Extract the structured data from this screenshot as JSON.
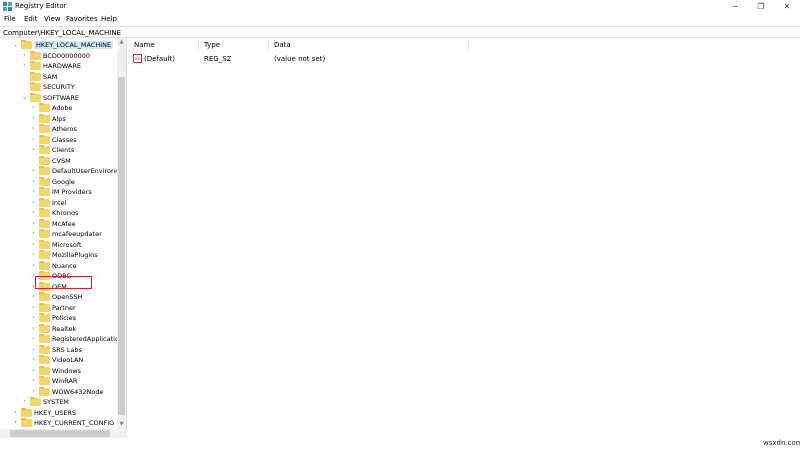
{
  "window": {
    "title": "Registry Editor",
    "minimize": "─",
    "maximize": "❐",
    "close": "✕"
  },
  "menu": [
    "File",
    "Edit",
    "View",
    "Favorites",
    "Help"
  ],
  "address": "Computer\\HKEY_LOCAL_MACHINE",
  "tree": {
    "root": "HKEY_LOCAL_MACHINE",
    "hklm_children": [
      "BCD00000000",
      "HARDWARE",
      "SAM",
      "SECURITY",
      "SOFTWARE"
    ],
    "software_children": [
      "Adobe",
      "Alps",
      "Atheros",
      "Classes",
      "Clients",
      "CVSM",
      "DefaultUserEnvironm",
      "Google",
      "IM Providers",
      "Intel",
      "Khronos",
      "McAfee",
      "mcafeeupdater",
      "Microsoft",
      "MozillaPlugins",
      "Nuance",
      "ODBC",
      "OEM",
      "OpenSSH",
      "Partner",
      "Policies",
      "Realtek",
      "RegisteredApplicatio",
      "SRS Labs",
      "VideoLAN",
      "Windows",
      "WinRAR",
      "WOW6432Node"
    ],
    "after_software": [
      "SYSTEM"
    ],
    "other_roots": [
      "HKEY_USERS",
      "HKEY_CURRENT_CONFIG"
    ]
  },
  "list": {
    "columns": [
      "Name",
      "Type",
      "Data"
    ],
    "rows": [
      {
        "name": "(Default)",
        "type": "REG_SZ",
        "data": "(value not set)",
        "icon": "ab-string-icon"
      }
    ]
  },
  "watermark": "wsxdn.com"
}
